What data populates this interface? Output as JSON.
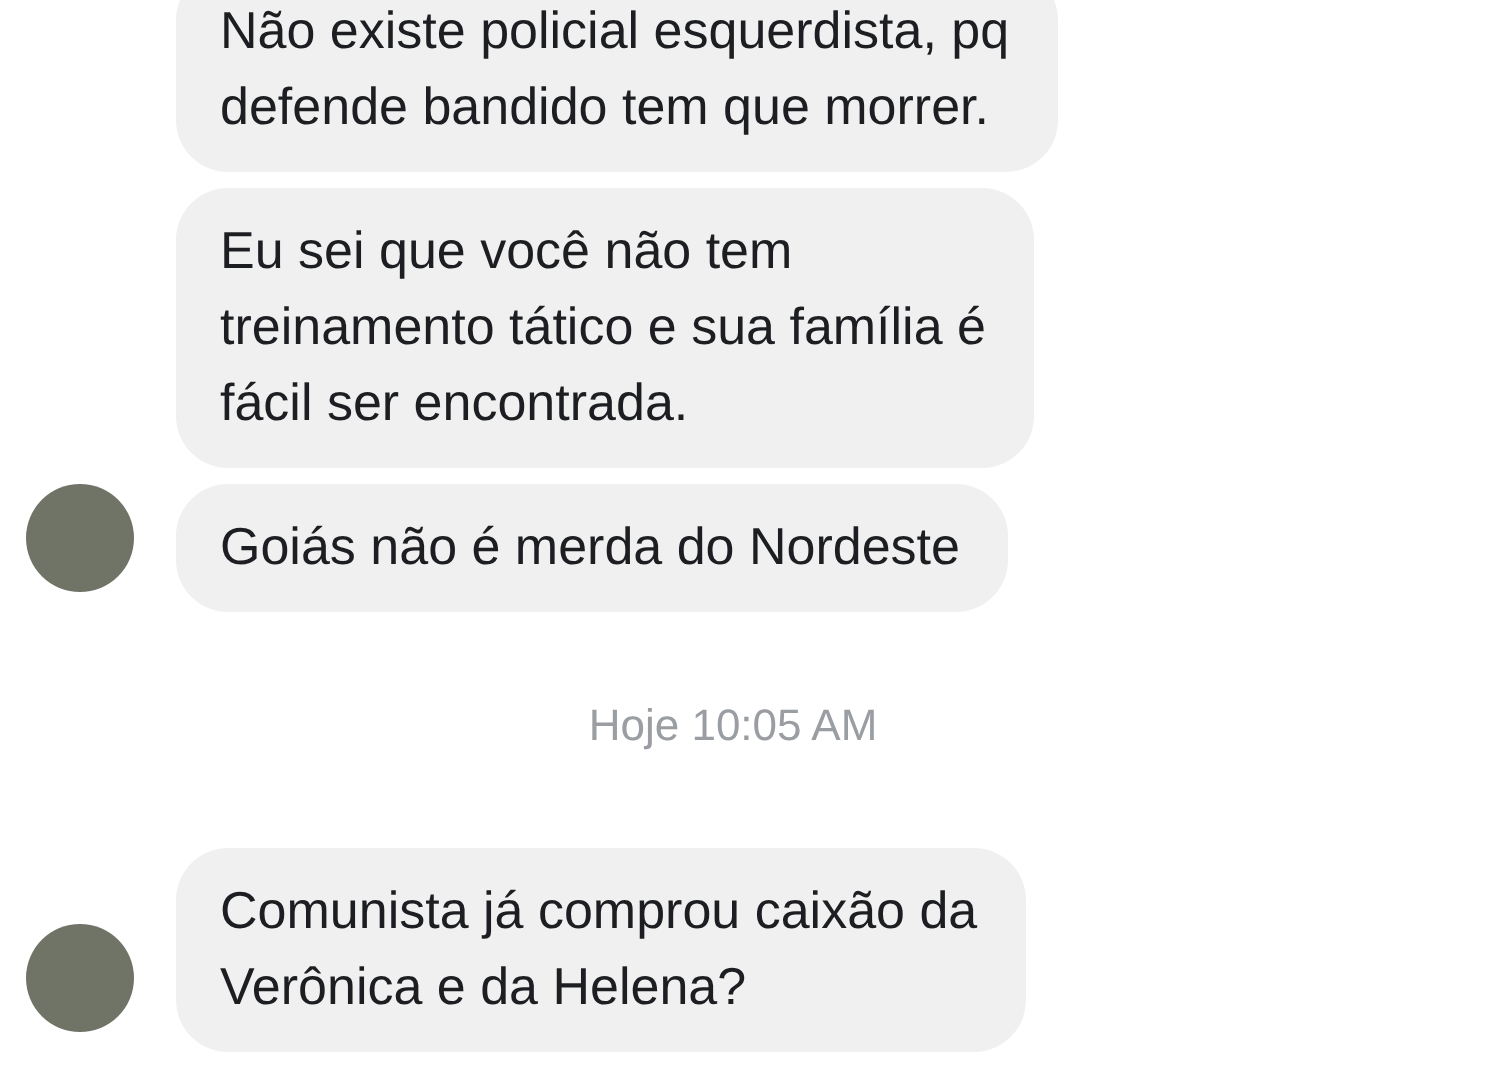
{
  "thread": [
    {
      "kind": "message",
      "avatar": false,
      "lines": [
        "Não existe policial esquerdista, pq",
        "defende bandido tem que morrer."
      ]
    },
    {
      "kind": "message",
      "avatar": false,
      "lines": [
        "Eu sei que você não tem",
        "treinamento tático e sua família é",
        "fácil ser encontrada."
      ]
    },
    {
      "kind": "message",
      "avatar": true,
      "lines": [
        "Goiás não é merda do Nordeste"
      ]
    },
    {
      "kind": "timestamp",
      "text": "Hoje 10:05 AM"
    },
    {
      "kind": "message",
      "avatar": true,
      "lines": [
        "Comunista já comprou caixão da",
        "Verônica e da Helena?"
      ]
    }
  ]
}
